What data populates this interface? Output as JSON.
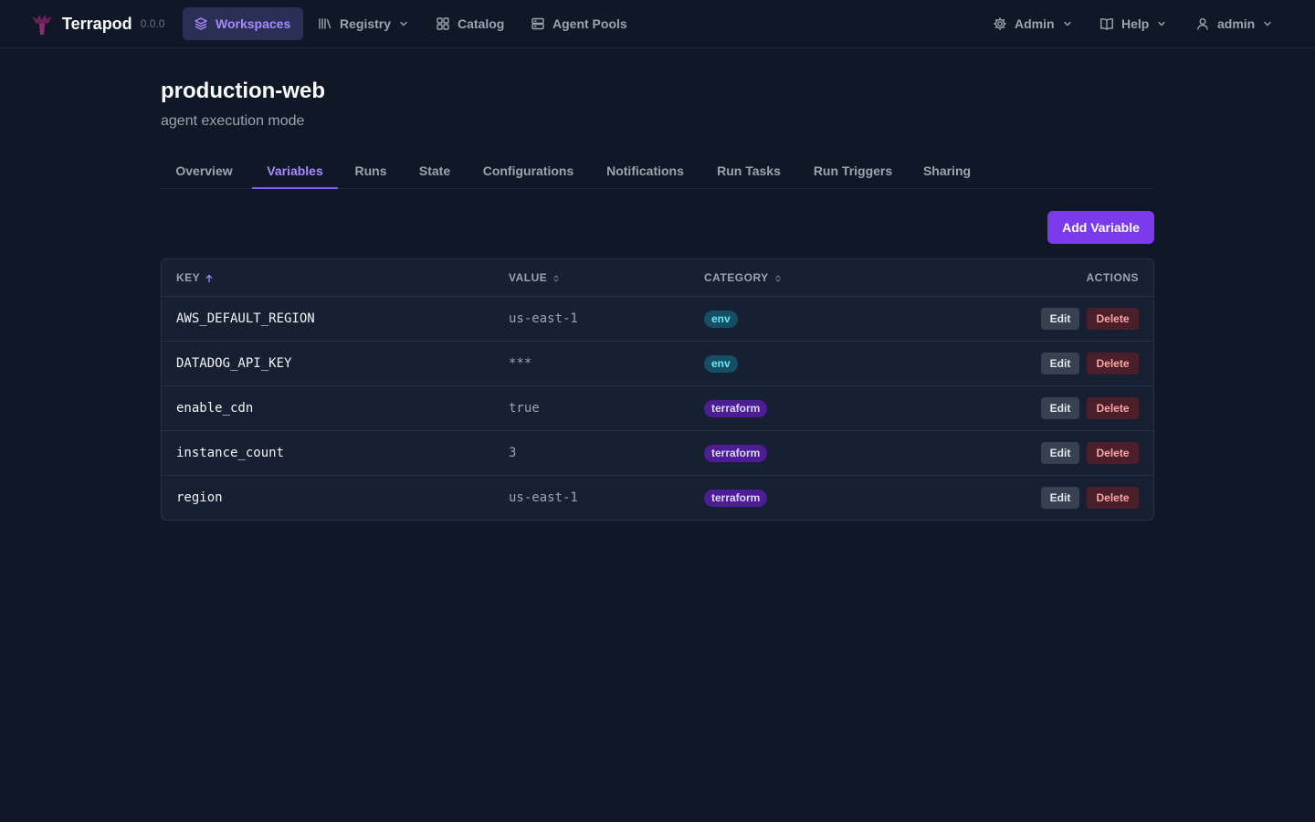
{
  "nav": {
    "brand": "Terrapod",
    "version": "0.0.0",
    "items": [
      {
        "label": "Workspaces",
        "icon": "layers-icon"
      },
      {
        "label": "Registry",
        "icon": "library-icon"
      },
      {
        "label": "Catalog",
        "icon": "grid-icon"
      },
      {
        "label": "Agent Pools",
        "icon": "server-icon"
      }
    ],
    "right": [
      {
        "label": "Admin",
        "icon": "gear-icon"
      },
      {
        "label": "Help",
        "icon": "book-icon"
      },
      {
        "label": "admin",
        "icon": "user-icon"
      }
    ]
  },
  "workspace": {
    "name": "production-web",
    "subtitle": "agent execution mode"
  },
  "tabs": [
    {
      "label": "Overview"
    },
    {
      "label": "Variables",
      "active": true
    },
    {
      "label": "Runs"
    },
    {
      "label": "State"
    },
    {
      "label": "Configurations"
    },
    {
      "label": "Notifications"
    },
    {
      "label": "Run Tasks"
    },
    {
      "label": "Run Triggers"
    },
    {
      "label": "Sharing"
    }
  ],
  "actions": {
    "add_variable": "Add Variable"
  },
  "table": {
    "columns": {
      "key": "KEY",
      "value": "VALUE",
      "category": "CATEGORY",
      "actions": "ACTIONS"
    },
    "edit_label": "Edit",
    "delete_label": "Delete",
    "rows": [
      {
        "key": "AWS_DEFAULT_REGION",
        "value": "us-east-1",
        "category": "env"
      },
      {
        "key": "DATADOG_API_KEY",
        "value": "***",
        "category": "env"
      },
      {
        "key": "enable_cdn",
        "value": "true",
        "category": "terraform"
      },
      {
        "key": "instance_count",
        "value": "3",
        "category": "terraform"
      },
      {
        "key": "region",
        "value": "us-east-1",
        "category": "terraform"
      }
    ]
  },
  "colors": {
    "background": "#101828",
    "accent": "#7c3aed",
    "accent_text": "#a78bfa",
    "env_badge": "#164e63",
    "terraform_badge": "#4c1d95"
  }
}
